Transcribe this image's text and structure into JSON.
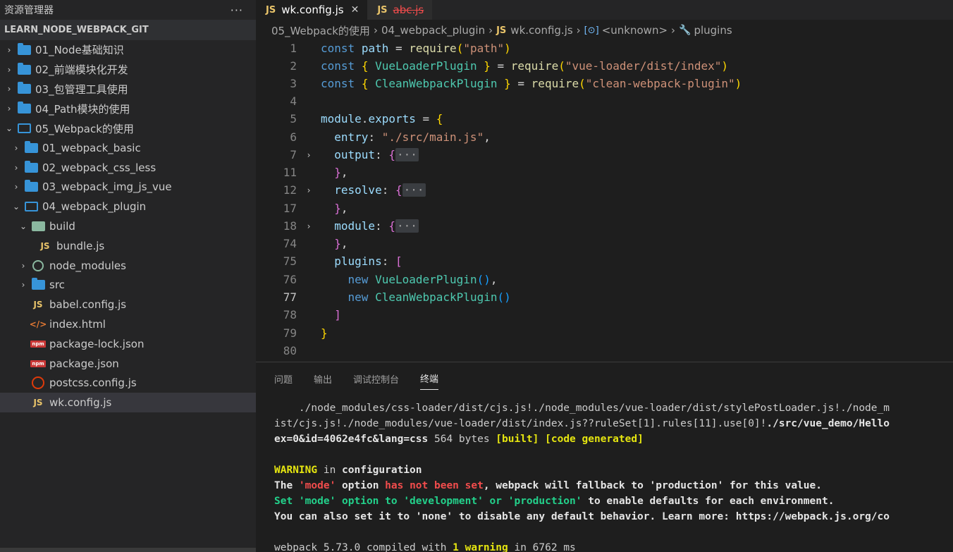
{
  "sidebar": {
    "header_title": "资源管理器",
    "more_label": "···",
    "project_title": "LEARN_NODE_WEBPACK_GIT",
    "items": [
      {
        "label": "01_Node基础知识",
        "icon": "folder-icon",
        "chevron": "›"
      },
      {
        "label": "02_前端模块化开发",
        "icon": "folder-icon",
        "chevron": "›"
      },
      {
        "label": "03_包管理工具使用",
        "icon": "folder-icon",
        "chevron": "›"
      },
      {
        "label": "04_Path模块的使用",
        "icon": "folder-icon",
        "chevron": "›"
      },
      {
        "label": "05_Webpack的使用",
        "icon": "folder-open-icon",
        "chevron": "⌄"
      },
      {
        "label": "01_webpack_basic",
        "icon": "folder-icon",
        "chevron": "›"
      },
      {
        "label": "02_webpack_css_less",
        "icon": "folder-icon",
        "chevron": "›"
      },
      {
        "label": "03_webpack_img_js_vue",
        "icon": "folder-icon",
        "chevron": "›"
      },
      {
        "label": "04_webpack_plugin",
        "icon": "folder-open-icon",
        "chevron": "⌄"
      },
      {
        "label": "build",
        "icon": "build-folder-icon",
        "chevron": "⌄"
      },
      {
        "label": "bundle.js",
        "icon": "js-file-icon",
        "js_text": "JS"
      },
      {
        "label": "node_modules",
        "icon": "node-modules-icon",
        "chevron": "›"
      },
      {
        "label": "src",
        "icon": "folder-icon",
        "chevron": "›"
      },
      {
        "label": "babel.config.js",
        "icon": "js-file-icon",
        "js_text": "JS"
      },
      {
        "label": "index.html",
        "icon": "html-file-icon",
        "html_text": "</>"
      },
      {
        "label": "package-lock.json",
        "icon": "npm-icon",
        "npm_text": "npm"
      },
      {
        "label": "package.json",
        "icon": "npm-icon",
        "npm_text": "npm"
      },
      {
        "label": "postcss.config.js",
        "icon": "postcss-icon"
      },
      {
        "label": "wk.config.js",
        "icon": "js-file-icon",
        "js_text": "JS"
      }
    ]
  },
  "tabs": [
    {
      "label": "wk.config.js",
      "icon_text": "JS",
      "close": "✕"
    },
    {
      "label": "abc.js",
      "icon_text": "JS"
    }
  ],
  "breadcrumb": {
    "p1": "05_Webpack的使用",
    "p2": "04_webpack_plugin",
    "js": "JS",
    "p3": "wk.config.js",
    "sym": "[⊙]",
    "p4": "<unknown>",
    "wrench": "🔧",
    "p5": "plugins",
    "sep": "›"
  },
  "editor": {
    "line_numbers": [
      "1",
      "2",
      "3",
      "4",
      "5",
      "6",
      "7",
      "11",
      "12",
      "17",
      "18",
      "74",
      "75",
      "76",
      "77",
      "78",
      "79",
      "80"
    ],
    "fold_arrow": "›",
    "ellipsis": "···"
  },
  "panel": {
    "tabs": [
      "问题",
      "输出",
      "调试控制台",
      "终端"
    ],
    "terminal": {
      "l1": "    ./node_modules/css-loader/dist/cjs.js!./node_modules/vue-loader/dist/stylePostLoader.js!./node_m",
      "l2a": "ist/cjs.js!./node_modules/vue-loader/dist/index.js??ruleSet[1].rules[11].use[0]!",
      "l2b": "./src/vue_demo/Hello",
      "l3a": "ex=0&id=4062e4fc&lang=css",
      "l3b": " 564 bytes ",
      "l3c": "[built]",
      "l3d": " ",
      "l3e": "[code generated]",
      "l4a": "WARNING",
      "l4b": " in ",
      "l4c": "configuration",
      "l5": "The 'mode' option has not been set, webpack will fallback to 'production' for this value.",
      "l6a": "Set 'mode' option to 'development' or 'production'",
      "l6b": " to enable defaults for each environment.",
      "l7": "You can also set it to 'none' to disable any default behavior. Learn more: https://webpack.js.org/co",
      "l8a": "webpack 5.73.0 compiled with ",
      "l8b": "1 warning",
      "l8c": " in 6762 ms"
    }
  }
}
